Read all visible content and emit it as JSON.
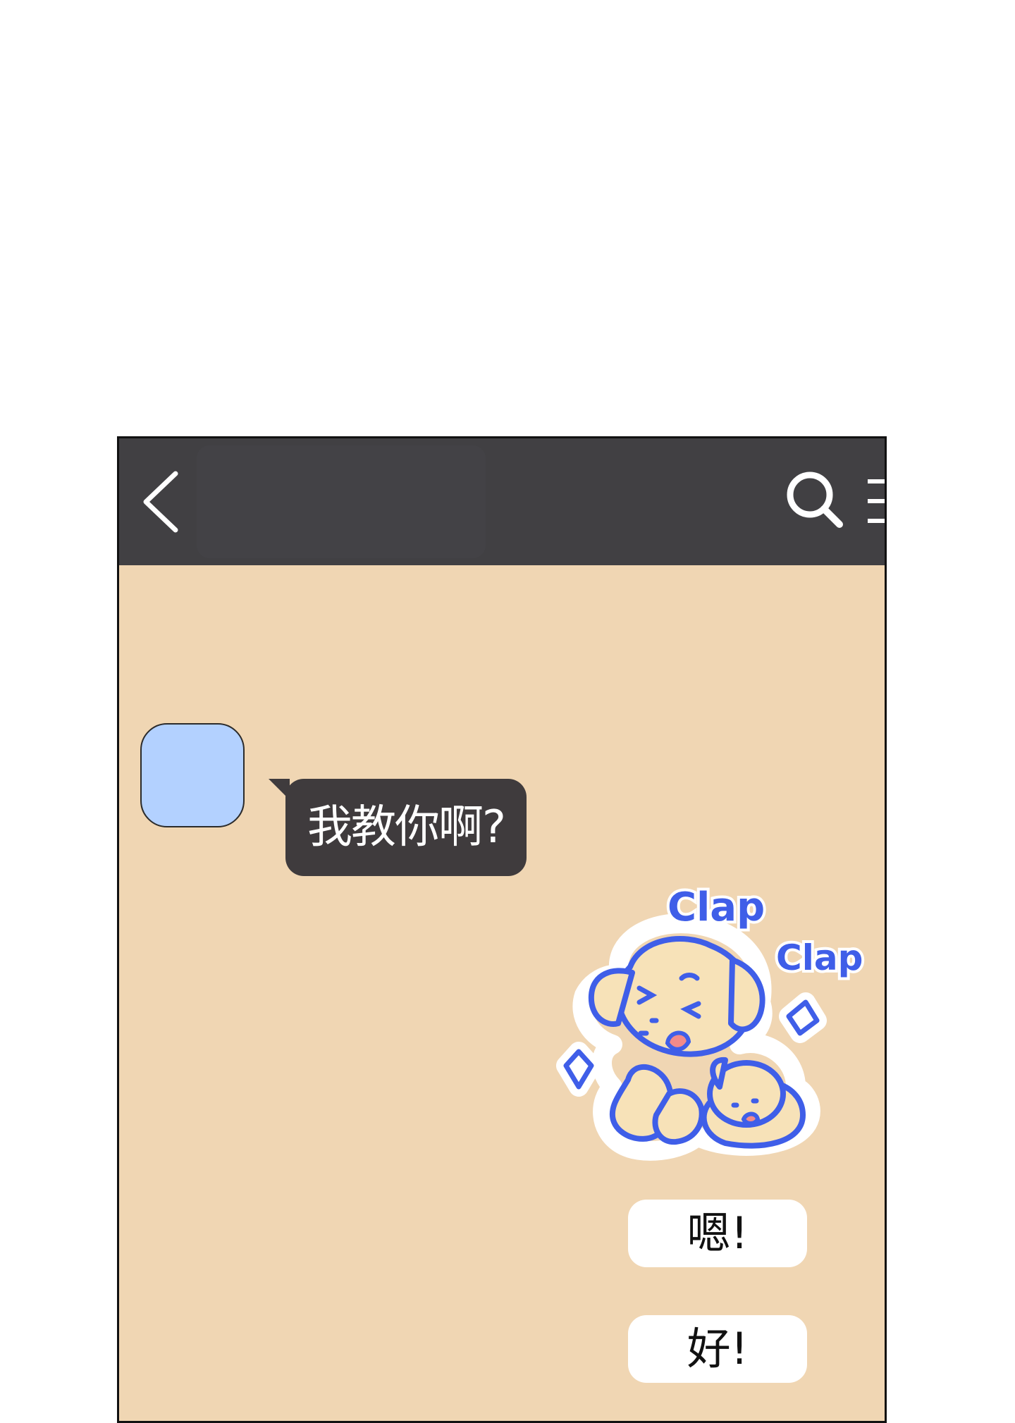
{
  "header": {
    "back_icon": "chevron-left-icon",
    "search_icon": "search-icon",
    "menu_icon": "menu-icon"
  },
  "messages": [
    {
      "side": "left",
      "text": "我教你啊?"
    },
    {
      "side": "right",
      "type": "sticker",
      "sticker_words": [
        "Clap",
        "Clap"
      ]
    },
    {
      "side": "right",
      "text": "嗯!"
    },
    {
      "side": "right",
      "text": "好!"
    }
  ],
  "colors": {
    "header_bg": "#414043",
    "chat_bg": "#f0d6b3",
    "avatar": "#b3d1ff",
    "incoming_bubble": "#3f3b3d",
    "outgoing_bubble": "#ffffff",
    "sticker_outline": "#3f5ee8"
  }
}
